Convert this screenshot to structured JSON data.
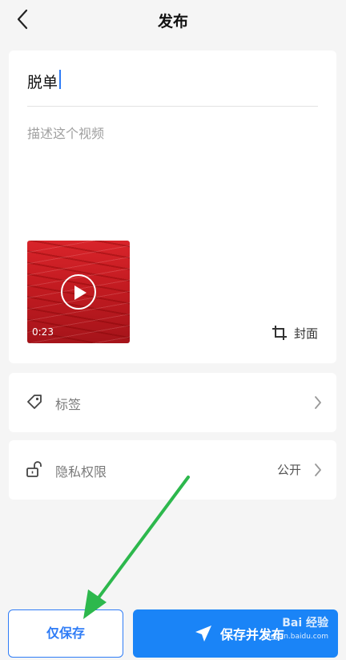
{
  "header": {
    "title": "发布"
  },
  "post": {
    "title_value": "脱单",
    "description_placeholder": "描述这个视频",
    "video_duration": "0:23",
    "cover_label": "封面"
  },
  "rows": {
    "tags_label": "标签",
    "privacy_label": "隐私权限",
    "privacy_value": "公开"
  },
  "footer": {
    "save_only_label": "仅保存",
    "save_publish_label": "保存并发布"
  },
  "watermark": {
    "brand": "Bai 经验",
    "url": "jingyan.baidu.com"
  },
  "colors": {
    "accent": "#1a84f7",
    "arrow": "#2db84d",
    "video": "#c31b21"
  }
}
